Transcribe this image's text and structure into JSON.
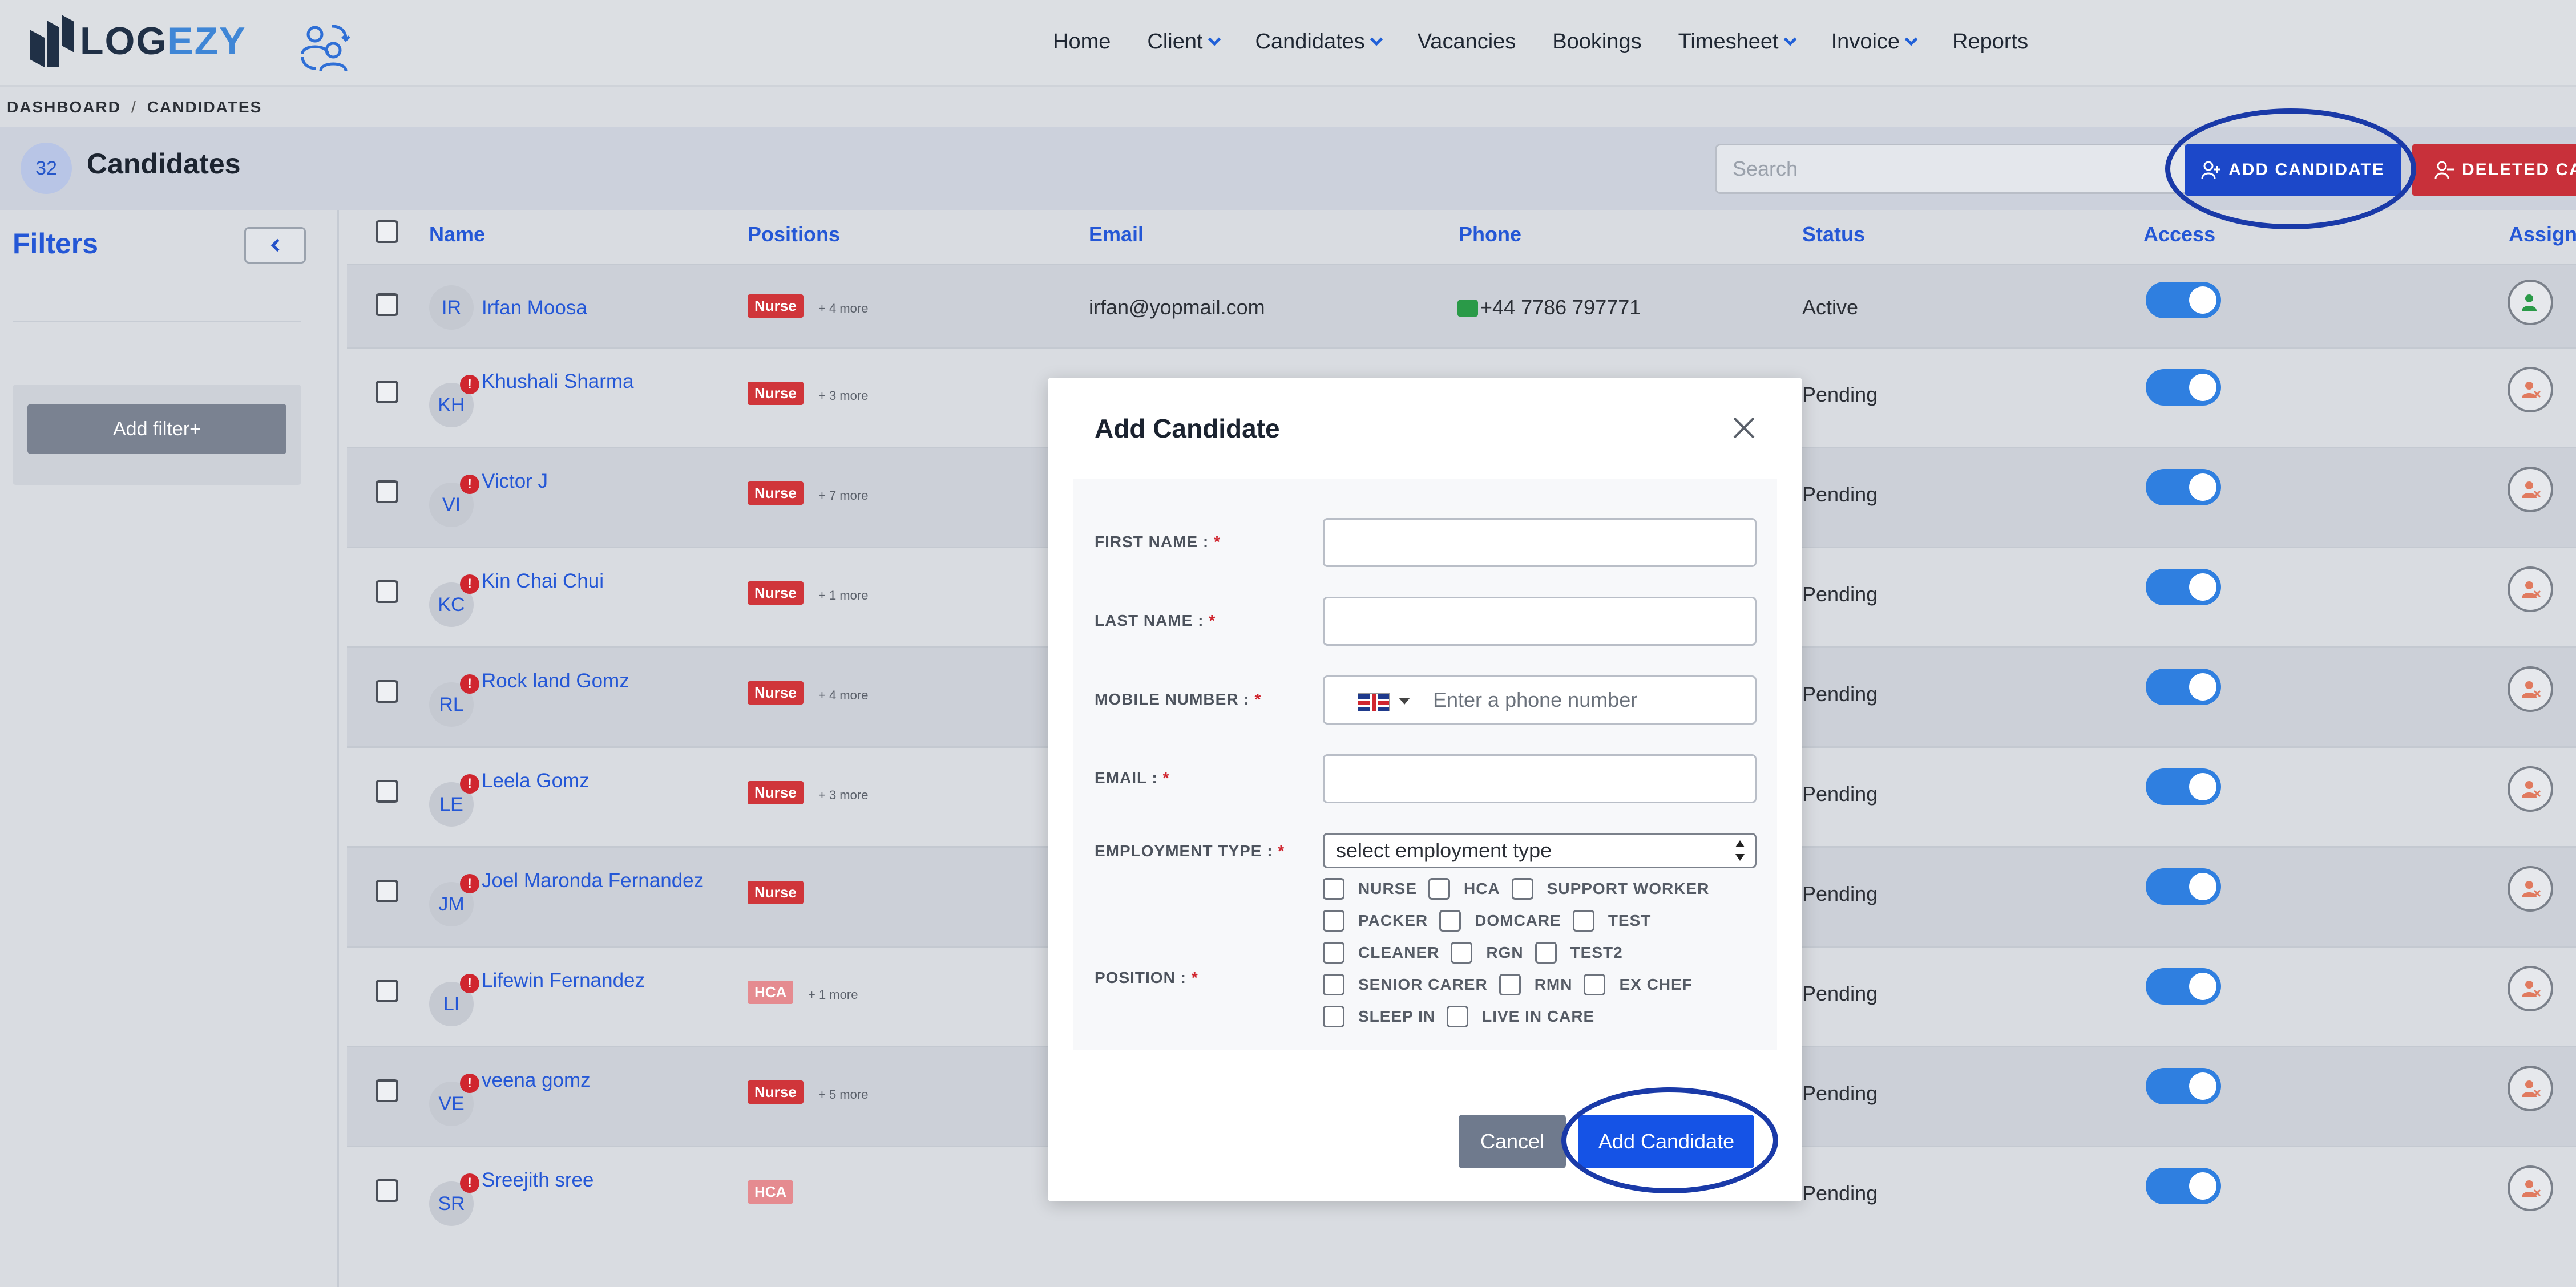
{
  "brand": {
    "logo_prefix": "LOG",
    "logo_suffix": "EZY"
  },
  "nav": [
    {
      "label": "Home",
      "dropdown": false
    },
    {
      "label": "Client",
      "dropdown": true
    },
    {
      "label": "Candidates",
      "dropdown": true
    },
    {
      "label": "Vacancies",
      "dropdown": false
    },
    {
      "label": "Bookings",
      "dropdown": false
    },
    {
      "label": "Timesheet",
      "dropdown": true
    },
    {
      "label": "Invoice",
      "dropdown": true
    },
    {
      "label": "Reports",
      "dropdown": false
    }
  ],
  "breadcrumb": {
    "root": "DASHBOARD",
    "separator": "/",
    "current": "CANDIDATES"
  },
  "page": {
    "count": "32",
    "title": "Candidates",
    "search_placeholder": "Search",
    "add_button": "ADD CANDIDATE",
    "deleted_button": "DELETED CAN"
  },
  "filters": {
    "title": "Filters",
    "add_filter": "Add filter+"
  },
  "table": {
    "headers": {
      "name": "Name",
      "positions": "Positions",
      "email": "Email",
      "phone": "Phone",
      "status": "Status",
      "access": "Access",
      "assign": "Assign"
    },
    "rows": [
      {
        "initials": "IR",
        "name": "Irfan Moosa",
        "alert": false,
        "position": "Nurse",
        "more": "+ 4 more",
        "email": "irfan@yopmail.com",
        "phone": "+44 7786 797771",
        "status": "Active",
        "assigned": true
      },
      {
        "initials": "KH",
        "name": "Khushali Sharma",
        "alert": true,
        "position": "Nurse",
        "more": "+ 3 more",
        "email": "",
        "phone": "",
        "status": "Pending",
        "assigned": false
      },
      {
        "initials": "VI",
        "name": "Victor J",
        "alert": true,
        "position": "Nurse",
        "more": "+ 7 more",
        "email": "",
        "phone": "",
        "status": "Pending",
        "assigned": false
      },
      {
        "initials": "KC",
        "name": "Kin Chai Chui",
        "alert": true,
        "position": "Nurse",
        "more": "+ 1 more",
        "email": "",
        "phone": "",
        "status": "Pending",
        "assigned": false
      },
      {
        "initials": "RL",
        "name": "Rock land Gomz",
        "alert": true,
        "position": "Nurse",
        "more": "+ 4 more",
        "email": "",
        "phone": "",
        "status": "Pending",
        "assigned": false
      },
      {
        "initials": "LE",
        "name": "Leela Gomz",
        "alert": true,
        "position": "Nurse",
        "more": "+ 3 more",
        "email": "",
        "phone": "",
        "status": "Pending",
        "assigned": false
      },
      {
        "initials": "JM",
        "name": "Joel Maronda Fernandez",
        "alert": true,
        "position": "Nurse",
        "more": "",
        "email": "",
        "phone": "",
        "status": "Pending",
        "assigned": false
      },
      {
        "initials": "LI",
        "name": "Lifewin Fernandez",
        "alert": true,
        "position": "HCA",
        "more": "+ 1 more",
        "email": "",
        "phone": "",
        "status": "Pending",
        "assigned": false
      },
      {
        "initials": "VE",
        "name": "veena gomz",
        "alert": true,
        "position": "Nurse",
        "more": "+ 5 more",
        "email": "",
        "phone": "",
        "status": "Pending",
        "assigned": false
      },
      {
        "initials": "SR",
        "name": "Sreejith sree",
        "alert": true,
        "position": "HCA",
        "more": "",
        "email": "",
        "phone": "",
        "status": "Pending",
        "assigned": false
      }
    ]
  },
  "modal": {
    "title": "Add Candidate",
    "first_name_label": "FIRST NAME :",
    "last_name_label": "LAST NAME :",
    "mobile_label": "MOBILE NUMBER :",
    "mobile_placeholder": "Enter a phone number",
    "email_label": "EMAIL :",
    "employment_label": "EMPLOYMENT TYPE :",
    "employment_value": "select employment type",
    "position_label": "POSITION :",
    "required_mark": "*",
    "position_rows": [
      [
        "NURSE",
        "HCA",
        "SUPPORT WORKER"
      ],
      [
        "PACKER",
        "DOMCARE",
        "TEST"
      ],
      [
        "CLEANER",
        "RGN",
        "TEST2"
      ],
      [
        "SENIOR CARER",
        "RMN",
        "EX CHEF"
      ],
      [
        "SLEEP IN",
        "LIVE IN CARE"
      ]
    ],
    "cancel": "Cancel",
    "submit": "Add Candidate"
  },
  "colors": {
    "primary": "#1c48c9",
    "danger": "#c8303a",
    "link": "#2457d6",
    "toggle": "#2f7fe0"
  }
}
